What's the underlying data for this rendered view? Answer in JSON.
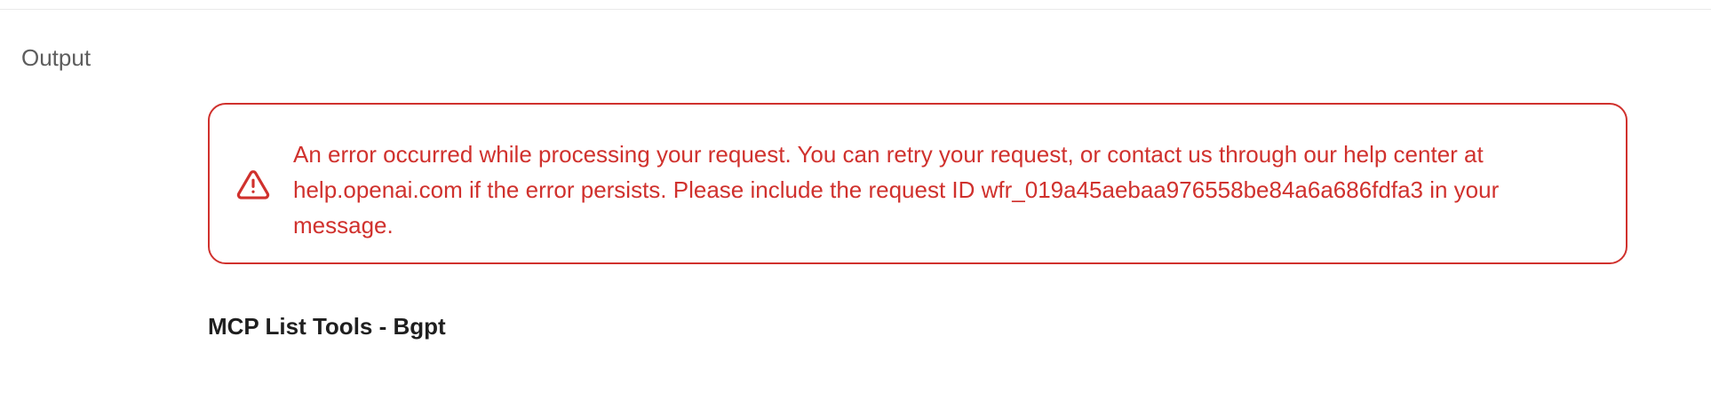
{
  "output_section": {
    "label": "Output"
  },
  "error": {
    "icon": "warning-triangle-icon",
    "color": "#d0312d",
    "message": "An error occurred while processing your request. You can retry your request, or contact us through our help center at help.openai.com if the error persists. Please include the request ID wfr_019a45aebaa976558be84a6a686fdfa3 in your message."
  },
  "tools": {
    "heading": "MCP List Tools - Bgpt"
  }
}
